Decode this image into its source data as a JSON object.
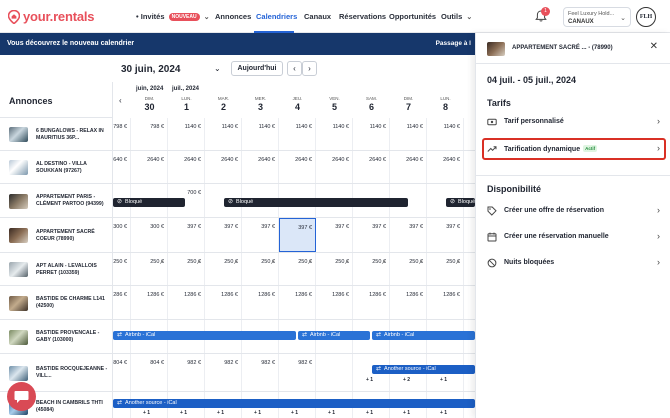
{
  "nav": {
    "logo": "your.rentals",
    "invite": "Invités",
    "invite_badge": "NOUVEAU",
    "annonces": "Annonces",
    "calendriers": "Calendriers",
    "canaux": "Canaux",
    "reservations": "Réservations",
    "opportunites": "Opportunités",
    "outils": "Outils",
    "notif_count": "1",
    "account_name": "Feel Luxury Hold...",
    "account_sub": "CANAUX",
    "avatar": "FLH"
  },
  "banner": {
    "text": "Vous découvrez le nouveau calendrier",
    "link": "Passage à l"
  },
  "calendar": {
    "date": "30 juin, 2024",
    "today": "Aujourd'hui",
    "annonces_title": "Annonces",
    "months": [
      {
        "label": "juin, 2024"
      },
      {
        "label": "juil., 2024"
      }
    ],
    "days": [
      {
        "dow": "DIM.",
        "num": "30"
      },
      {
        "dow": "LUN.",
        "num": "1"
      },
      {
        "dow": "MAR.",
        "num": "2"
      },
      {
        "dow": "MER.",
        "num": "3"
      },
      {
        "dow": "JEU.",
        "num": "4"
      },
      {
        "dow": "VEN.",
        "num": "5"
      },
      {
        "dow": "SAM.",
        "num": "6"
      },
      {
        "dow": "DIM.",
        "num": "7"
      },
      {
        "dow": "LUN.",
        "num": "8"
      }
    ],
    "listings": [
      {
        "name": "6 BUNGALOWS - RELAX IN MAURITIUS 36P...",
        "prices": [
          "798 €",
          "798 €",
          "1140 €",
          "1140 €",
          "1140 €",
          "1140 €",
          "1140 €",
          "1140 €",
          "1140 €",
          "1140 €"
        ]
      },
      {
        "name": "AL DESTINO - VILLA SOUKKAN (97267)",
        "prices": [
          "2640 €",
          "2640 €",
          "2640 €",
          "2640 €",
          "2640 €",
          "2640 €",
          "2640 €",
          "2640 €",
          "2640 €",
          "2640 €"
        ]
      },
      {
        "name": "Appartement Paris - Clément Partoo (94399)",
        "prices": [
          "",
          "",
          "700 €",
          "",
          "",
          "",
          "",
          "",
          "",
          ""
        ]
      },
      {
        "name": "APPARTEMENT SACRÉ COEUR (78990)",
        "prices": [
          "300 €",
          "300 €",
          "397 €",
          "397 €",
          "397 €",
          "397 €",
          "397 €",
          "397 €",
          "397 €",
          "397 €"
        ]
      },
      {
        "name": "Apt Alain - Levallois Perret (103359)",
        "prices": [
          "250 €",
          "250 €",
          "250 €",
          "250 €",
          "250 €",
          "250 €",
          "250 €",
          "250 €",
          "250 €",
          "250 €"
        ]
      },
      {
        "name": "BASTIDE DE CHARME L141 (42500)",
        "prices": [
          "1286 €",
          "1286 €",
          "1286 €",
          "1286 €",
          "1286 €",
          "1286 €",
          "1286 €",
          "1286 €",
          "1286 €",
          "1286 €"
        ]
      },
      {
        "name": "BASTIDE PROVENCALE - GABY (103000)",
        "prices": [
          "",
          "",
          "",
          "",
          "",
          "",
          "",
          "",
          "",
          ""
        ]
      },
      {
        "name": "BASTIDE ROCQUEJEANNE - VILL...",
        "prices": [
          "804 €",
          "804 €",
          "982 €",
          "982 €",
          "982 €",
          "982 €",
          "",
          "",
          "",
          ""
        ]
      },
      {
        "name": "BEACH IN CAMBRILS THTI (45084)",
        "prices": [
          "",
          "",
          "",
          "",
          "",
          "",
          "",
          "",
          "",
          ""
        ]
      }
    ],
    "blocked": "Bloqué",
    "airbnb": "Airbnb - iCal",
    "other_source": "Another source - iCal",
    "plus_one": "+ 1",
    "plus_two": "+ 2"
  },
  "panel": {
    "listing": "APPARTEMENT SACRÉ ... - (78990)",
    "range": "04 juil. - 05 juil., 2024",
    "tarifs_title": "Tarifs",
    "tarif_perso": "Tarif personnalisé",
    "tarif_dyn": "Tarification dynamique",
    "actif": "Actif",
    "dispo_title": "Disponibilité",
    "offre": "Créer une offre de réservation",
    "manuelle": "Créer une réservation manuelle",
    "nuits": "Nuits bloquées"
  },
  "colors": {
    "brand": "#e8505b",
    "accent": "#2463d6",
    "banner": "#16376b",
    "highlight": "#d93025"
  }
}
